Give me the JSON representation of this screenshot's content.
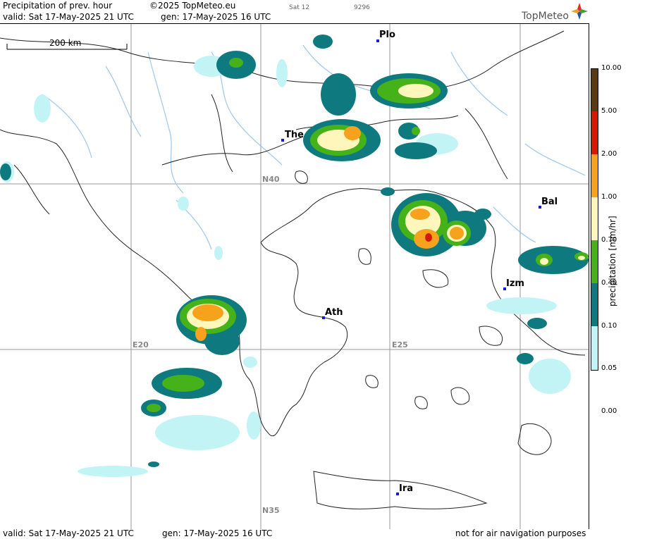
{
  "header": {
    "title": "Precipitation of prev. hour",
    "copyright": "©2025 TopMeteo.eu",
    "sat_label": "Sat 12",
    "code": "9296",
    "valid": "valid:  Sat  17-May-2025  21 UTC",
    "gen": "gen: 17-May-2025 16 UTC",
    "brand": "TopMeteo"
  },
  "map": {
    "scale": "200 km",
    "grid_labels": {
      "n40": "N40",
      "n35": "N35",
      "e20": "E20",
      "e25": "E25"
    },
    "cities": {
      "plo": "Plo",
      "the": "The",
      "bal": "Bal",
      "izm": "Izm",
      "ath": "Ath",
      "ira": "Ira"
    }
  },
  "legend": {
    "title": "precipitation [mm/hr]",
    "ticks": [
      "10.00",
      "5.00",
      "2.00",
      "1.00",
      "0.70",
      "0.40",
      "0.10",
      "0.05",
      "0.00"
    ],
    "colors": [
      "#5a3a10",
      "#d41a00",
      "#f6a21c",
      "#fff6bc",
      "#45b21a",
      "#0e7a80",
      "#c2f4f6",
      "#ffffff"
    ]
  },
  "footer": {
    "valid": "valid:  Sat  17-May-2025  21 UTC",
    "gen": "gen: 17-May-2025 16 UTC",
    "notice": "not for air navigation purposes"
  }
}
